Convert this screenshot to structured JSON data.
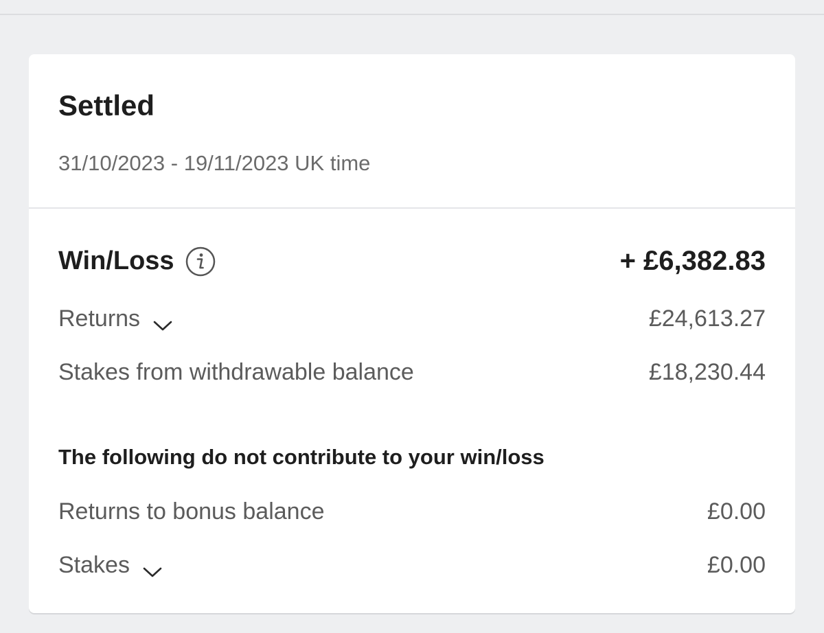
{
  "header": {
    "title": "Settled",
    "date_range": "31/10/2023 - 19/11/2023 UK time"
  },
  "summary": {
    "win_loss": {
      "label": "Win/Loss",
      "value": "+ £6,382.83",
      "icon": "info-icon"
    },
    "rows": [
      {
        "label": "Returns",
        "value": "£24,613.27",
        "expandable": true
      },
      {
        "label": "Stakes from withdrawable balance",
        "value": "£18,230.44",
        "expandable": false
      }
    ]
  },
  "non_contributing": {
    "heading": "The following do not contribute to your win/loss",
    "rows": [
      {
        "label": "Returns to bonus balance",
        "value": "£0.00",
        "expandable": false
      },
      {
        "label": "Stakes",
        "value": "£0.00",
        "expandable": true
      }
    ]
  },
  "colors": {
    "page_background": "#eeeff1",
    "card_background": "#ffffff",
    "primary_text": "#1e1e1e",
    "secondary_text": "#5b5b5b"
  }
}
